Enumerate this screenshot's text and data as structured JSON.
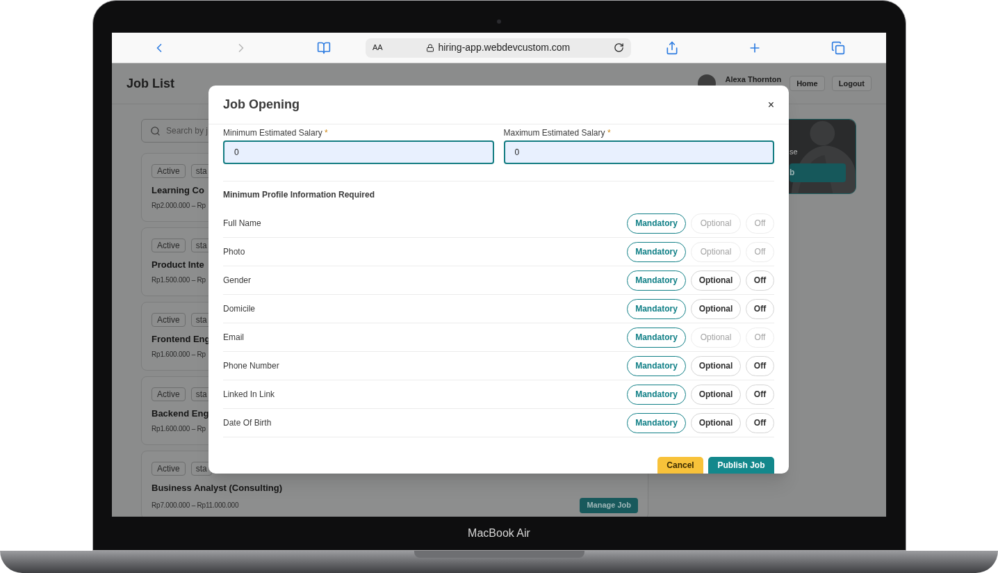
{
  "browser": {
    "reader_label": "AA",
    "url": "hiring-app.webdevcustom.com"
  },
  "device_label": "MacBook Air",
  "header": {
    "title": "Job List",
    "user_name": "Alexa Thornton",
    "buttons": [
      "Home",
      "Logout"
    ]
  },
  "search": {
    "placeholder": "Search by j"
  },
  "jobs": [
    {
      "status": "Active",
      "tag": "sta",
      "title": "Learning Co",
      "salary": "Rp2.000.000 – Rp"
    },
    {
      "status": "Active",
      "tag": "sta",
      "title": "Product Inte",
      "salary": "Rp1.500.000 – Rp"
    },
    {
      "status": "Active",
      "tag": "sta",
      "title": "Frontend Eng",
      "salary": "Rp1.600.000 – Rp"
    },
    {
      "status": "Active",
      "tag": "sta",
      "title": "Backend Eng",
      "salary": "Rp1.600.000 – Rp"
    },
    {
      "status": "Active",
      "tag": "sta",
      "title": "Business Analyst (Consulting)",
      "salary": "Rp7.000.000 – Rp11.000.000",
      "action": "Manage Job"
    }
  ],
  "promo": {
    "text": "se",
    "button": "b"
  },
  "modal": {
    "title": "Job Opening",
    "close": "×",
    "fields": [
      {
        "label": "Minimum Estimated Salary",
        "required_mark": "*",
        "value": "0"
      },
      {
        "label": "Maximum Estimated Salary",
        "required_mark": "*",
        "value": "0"
      }
    ],
    "section_title": "Minimum Profile Information Required",
    "requirements": [
      {
        "label": "Full Name",
        "options": [
          {
            "label": "Mandatory",
            "selected": true,
            "disabled": false
          },
          {
            "label": "Optional",
            "selected": false,
            "disabled": true
          },
          {
            "label": "Off",
            "selected": false,
            "disabled": true
          }
        ]
      },
      {
        "label": "Photo",
        "options": [
          {
            "label": "Mandatory",
            "selected": true,
            "disabled": false
          },
          {
            "label": "Optional",
            "selected": false,
            "disabled": true
          },
          {
            "label": "Off",
            "selected": false,
            "disabled": true
          }
        ]
      },
      {
        "label": "Gender",
        "options": [
          {
            "label": "Mandatory",
            "selected": true,
            "disabled": false
          },
          {
            "label": "Optional",
            "selected": false,
            "disabled": false
          },
          {
            "label": "Off",
            "selected": false,
            "disabled": false
          }
        ]
      },
      {
        "label": "Domicile",
        "options": [
          {
            "label": "Mandatory",
            "selected": true,
            "disabled": false
          },
          {
            "label": "Optional",
            "selected": false,
            "disabled": false
          },
          {
            "label": "Off",
            "selected": false,
            "disabled": false
          }
        ]
      },
      {
        "label": "Email",
        "options": [
          {
            "label": "Mandatory",
            "selected": true,
            "disabled": false
          },
          {
            "label": "Optional",
            "selected": false,
            "disabled": true
          },
          {
            "label": "Off",
            "selected": false,
            "disabled": true
          }
        ]
      },
      {
        "label": "Phone Number",
        "options": [
          {
            "label": "Mandatory",
            "selected": true,
            "disabled": false
          },
          {
            "label": "Optional",
            "selected": false,
            "disabled": false
          },
          {
            "label": "Off",
            "selected": false,
            "disabled": false
          }
        ]
      },
      {
        "label": "Linked In Link",
        "options": [
          {
            "label": "Mandatory",
            "selected": true,
            "disabled": false
          },
          {
            "label": "Optional",
            "selected": false,
            "disabled": false
          },
          {
            "label": "Off",
            "selected": false,
            "disabled": false
          }
        ]
      },
      {
        "label": "Date Of Birth",
        "options": [
          {
            "label": "Mandatory",
            "selected": true,
            "disabled": false
          },
          {
            "label": "Optional",
            "selected": false,
            "disabled": false
          },
          {
            "label": "Off",
            "selected": false,
            "disabled": false
          }
        ]
      }
    ],
    "buttons": [
      {
        "label": "Cancel",
        "kind": "cancel"
      },
      {
        "label": "Publish Job",
        "kind": "primary"
      }
    ]
  }
}
